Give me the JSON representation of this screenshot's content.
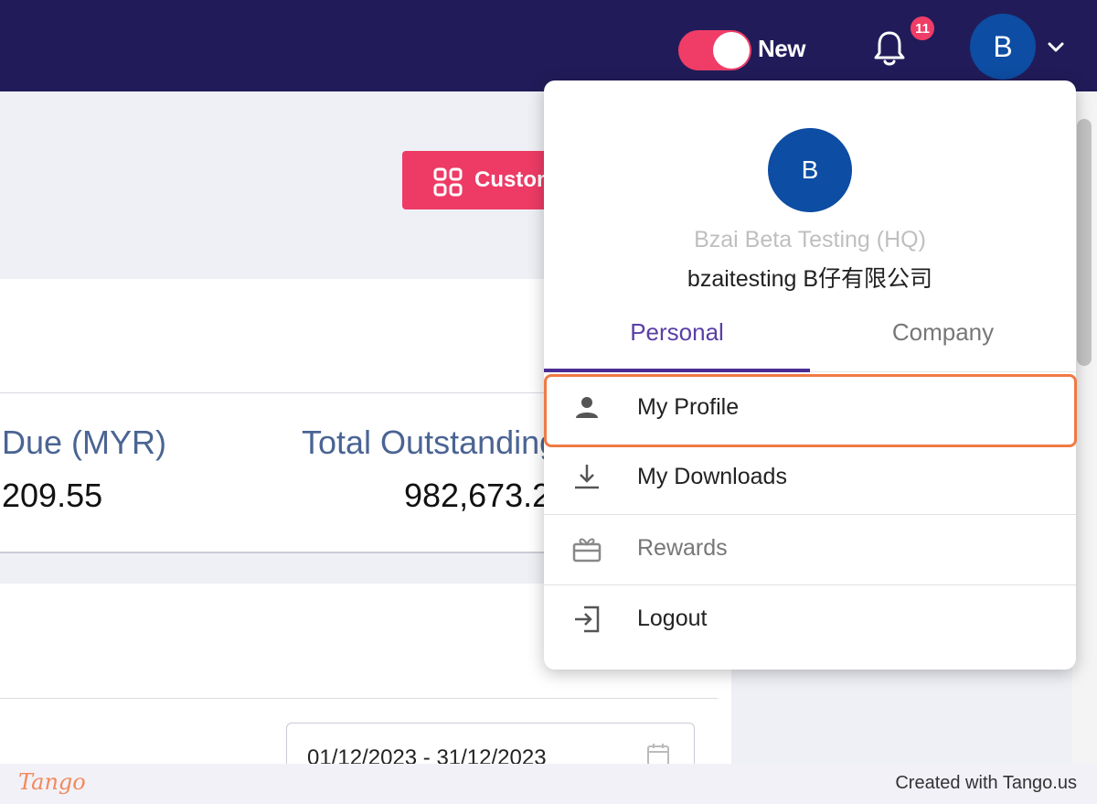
{
  "topbar": {
    "toggle_label": "New",
    "notification_count": "11",
    "avatar_initial": "B"
  },
  "header": {
    "custom_button_label": "Custom"
  },
  "stats": [
    {
      "label": "Due (MYR)",
      "value": "209.55"
    },
    {
      "label": "Total Outstanding",
      "value": "982,673.2"
    }
  ],
  "filter": {
    "date_range": "01/12/2023 - 31/12/2023"
  },
  "dropdown": {
    "avatar_initial": "B",
    "company": "Bzai Beta Testing (HQ)",
    "user_name": "bzaitesting B仔有限公司",
    "tabs": [
      {
        "label": "Personal",
        "active": true
      },
      {
        "label": "Company",
        "active": false
      }
    ],
    "menu": [
      {
        "label": "My Profile",
        "icon": "person-icon"
      },
      {
        "label": "My Downloads",
        "icon": "download-icon"
      },
      {
        "label": "Rewards",
        "icon": "gift-icon"
      },
      {
        "label": "Logout",
        "icon": "logout-icon"
      }
    ]
  },
  "footer": {
    "brand": "Tango",
    "credit": "Created with Tango.us"
  },
  "colors": {
    "topbar": "#211c59",
    "accent": "#ef3d68",
    "avatar": "#0d4da3",
    "tab_active": "#5b3fa6",
    "highlight": "#f07a45"
  }
}
